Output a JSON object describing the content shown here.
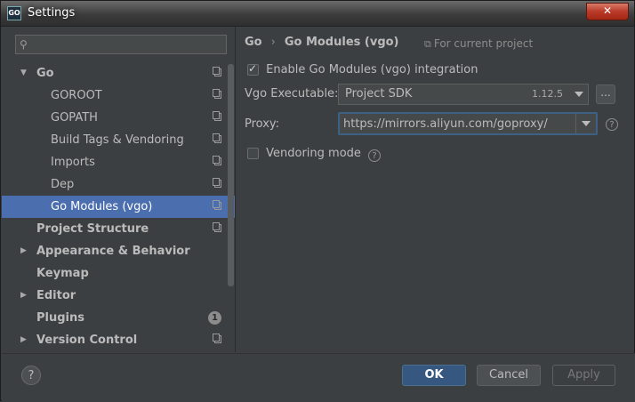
{
  "window": {
    "title": "Settings",
    "app_icon_text": "GO",
    "close_symbol": "✕"
  },
  "search": {
    "placeholder": "",
    "value": ""
  },
  "tree": [
    {
      "label": "Go",
      "bold": true,
      "arrow": "▼",
      "indent": 0
    },
    {
      "label": "GOROOT",
      "indent": 1
    },
    {
      "label": "GOPATH",
      "indent": 1
    },
    {
      "label": "Build Tags & Vendoring",
      "indent": 1
    },
    {
      "label": "Imports",
      "indent": 1
    },
    {
      "label": "Dep",
      "indent": 1
    },
    {
      "label": "Go Modules (vgo)",
      "indent": 1,
      "selected": true
    },
    {
      "label": "Project Structure",
      "bold": true
    },
    {
      "label": "Appearance & Behavior",
      "bold": true,
      "arrow": "▶"
    },
    {
      "label": "Keymap",
      "bold": true
    },
    {
      "label": "Editor",
      "bold": true,
      "arrow": "▶"
    },
    {
      "label": "Plugins",
      "bold": true,
      "badge": "1"
    },
    {
      "label": "Version Control",
      "bold": true,
      "arrow": "▶"
    }
  ],
  "breadcrumb": {
    "parent": "Go",
    "separator": "›",
    "current": "Go Modules (vgo)"
  },
  "scope_label": "For current project",
  "enable_modules": {
    "label": "Enable Go Modules (vgo) integration",
    "checked": true
  },
  "vgo_executable": {
    "label": "Vgo Executable:",
    "value": "Project SDK",
    "version": "1.12.5",
    "browse_label": "..."
  },
  "proxy": {
    "label": "Proxy:",
    "value": "https://mirrors.aliyun.com/goproxy/"
  },
  "vendoring": {
    "label": "Vendoring mode",
    "checked": false
  },
  "help_symbol": "?",
  "buttons": {
    "ok": "OK",
    "cancel": "Cancel",
    "apply": "Apply"
  },
  "colors": {
    "selection": "#4b6eaf",
    "ok_button": "#365880",
    "background": "#3c3f41"
  }
}
